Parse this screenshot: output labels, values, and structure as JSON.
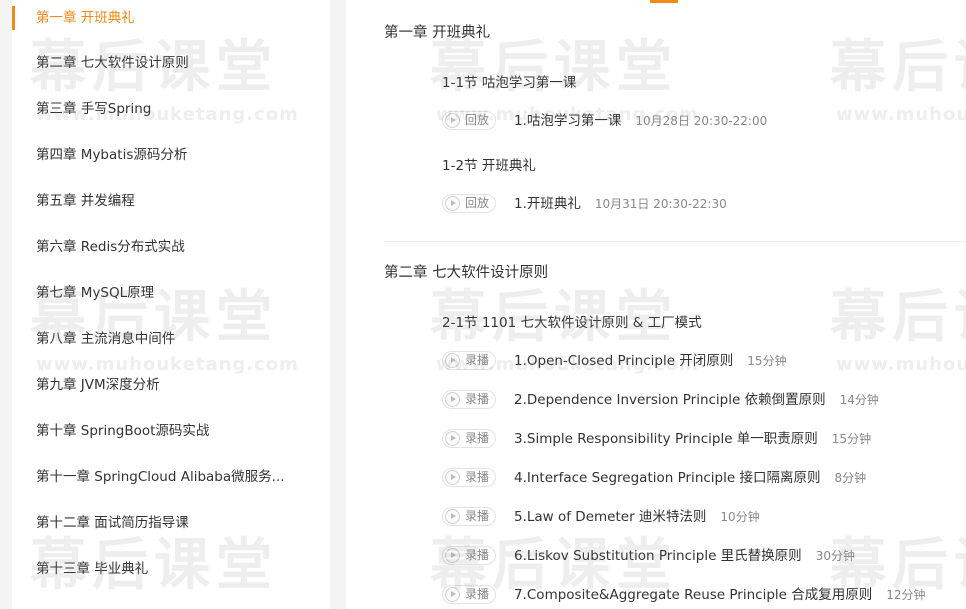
{
  "sidebar": {
    "items": [
      {
        "label": "第一章 开班典礼"
      },
      {
        "label": "第二章 七大软件设计原则"
      },
      {
        "label": "第三章 手写Spring"
      },
      {
        "label": "第四章 Mybatis源码分析"
      },
      {
        "label": "第五章 并发编程"
      },
      {
        "label": "第六章 Redis分布式实战"
      },
      {
        "label": "第七章 MySQL原理"
      },
      {
        "label": "第八章 主流消息中间件"
      },
      {
        "label": "第九章 JVM深度分析"
      },
      {
        "label": "第十章 SpringBoot源码实战"
      },
      {
        "label": "第十一章 SpringCloud Alibaba微服务..."
      },
      {
        "label": "第十二章 面试简历指导课"
      },
      {
        "label": "第十三章 毕业典礼"
      }
    ]
  },
  "main": {
    "chapters": [
      {
        "title": "第一章 开班典礼",
        "sections": [
          {
            "title": "1-1节 咕泡学习第一课",
            "lessons": [
              {
                "tag": "回放",
                "title": "1.咕泡学习第一课",
                "meta": "10月28日 20:30-22:00"
              }
            ]
          },
          {
            "title": "1-2节 开班典礼",
            "lessons": [
              {
                "tag": "回放",
                "title": "1.开班典礼",
                "meta": "10月31日 20:30-22:30"
              }
            ]
          }
        ]
      },
      {
        "title": "第二章 七大软件设计原则",
        "sections": [
          {
            "title": "2-1节 1101 七大软件设计原则 & 工厂模式",
            "lessons": [
              {
                "tag": "录播",
                "title": "1.Open-Closed Principle 开闭原则",
                "meta": "15分钟"
              },
              {
                "tag": "录播",
                "title": "2.Dependence Inversion Principle 依赖倒置原则",
                "meta": "14分钟"
              },
              {
                "tag": "录播",
                "title": "3.Simple Responsibility Principle 单一职责原则",
                "meta": "15分钟"
              },
              {
                "tag": "录播",
                "title": "4.Interface Segregation Principle 接口隔离原则",
                "meta": "8分钟"
              },
              {
                "tag": "录播",
                "title": "5.Law of Demeter 迪米特法则",
                "meta": "10分钟"
              },
              {
                "tag": "录播",
                "title": "6.Liskov Substitution Principle 里氏替换原则",
                "meta": "30分钟"
              },
              {
                "tag": "录播",
                "title": "7.Composite&Aggregate Reuse Principle 合成复用原则",
                "meta": "12分钟"
              }
            ]
          }
        ]
      }
    ]
  },
  "watermark": {
    "brand": "幕后课堂",
    "url": "www.muhouketang.com"
  },
  "colors": {
    "accent": "#f08a19",
    "text": "#333333",
    "muted": "#888888"
  }
}
